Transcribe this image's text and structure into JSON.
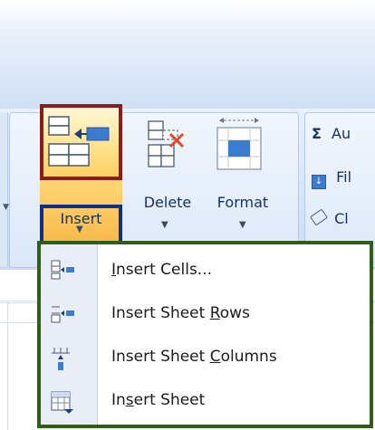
{
  "ribbon": {
    "cells_group": {
      "insert": {
        "label": "Insert"
      },
      "delete": {
        "label": "Delete"
      },
      "format": {
        "label": "Format"
      }
    },
    "editing_group": {
      "autosum": {
        "symbol": "Σ",
        "label_partial": "Au"
      },
      "fill": {
        "label_partial": "Fil"
      },
      "clear": {
        "label_partial": "Cl"
      }
    }
  },
  "insert_menu": {
    "items": [
      {
        "pre": "",
        "mnemonic": "I",
        "post": "nsert Cells...",
        "icon": "insert-cells-icon"
      },
      {
        "pre": "Insert Sheet ",
        "mnemonic": "R",
        "post": "ows",
        "icon": "insert-sheet-rows-icon"
      },
      {
        "pre": "Insert Sheet ",
        "mnemonic": "C",
        "post": "olumns",
        "icon": "insert-sheet-columns-icon"
      },
      {
        "pre": "In",
        "mnemonic": "s",
        "post": "ert Sheet",
        "icon": "insert-sheet-icon"
      }
    ]
  },
  "colors": {
    "highlight_red": "#8b1c1c",
    "highlight_blue": "#0f2f8c",
    "highlight_green": "#2f5e19",
    "ribbon_text": "#15325e"
  }
}
